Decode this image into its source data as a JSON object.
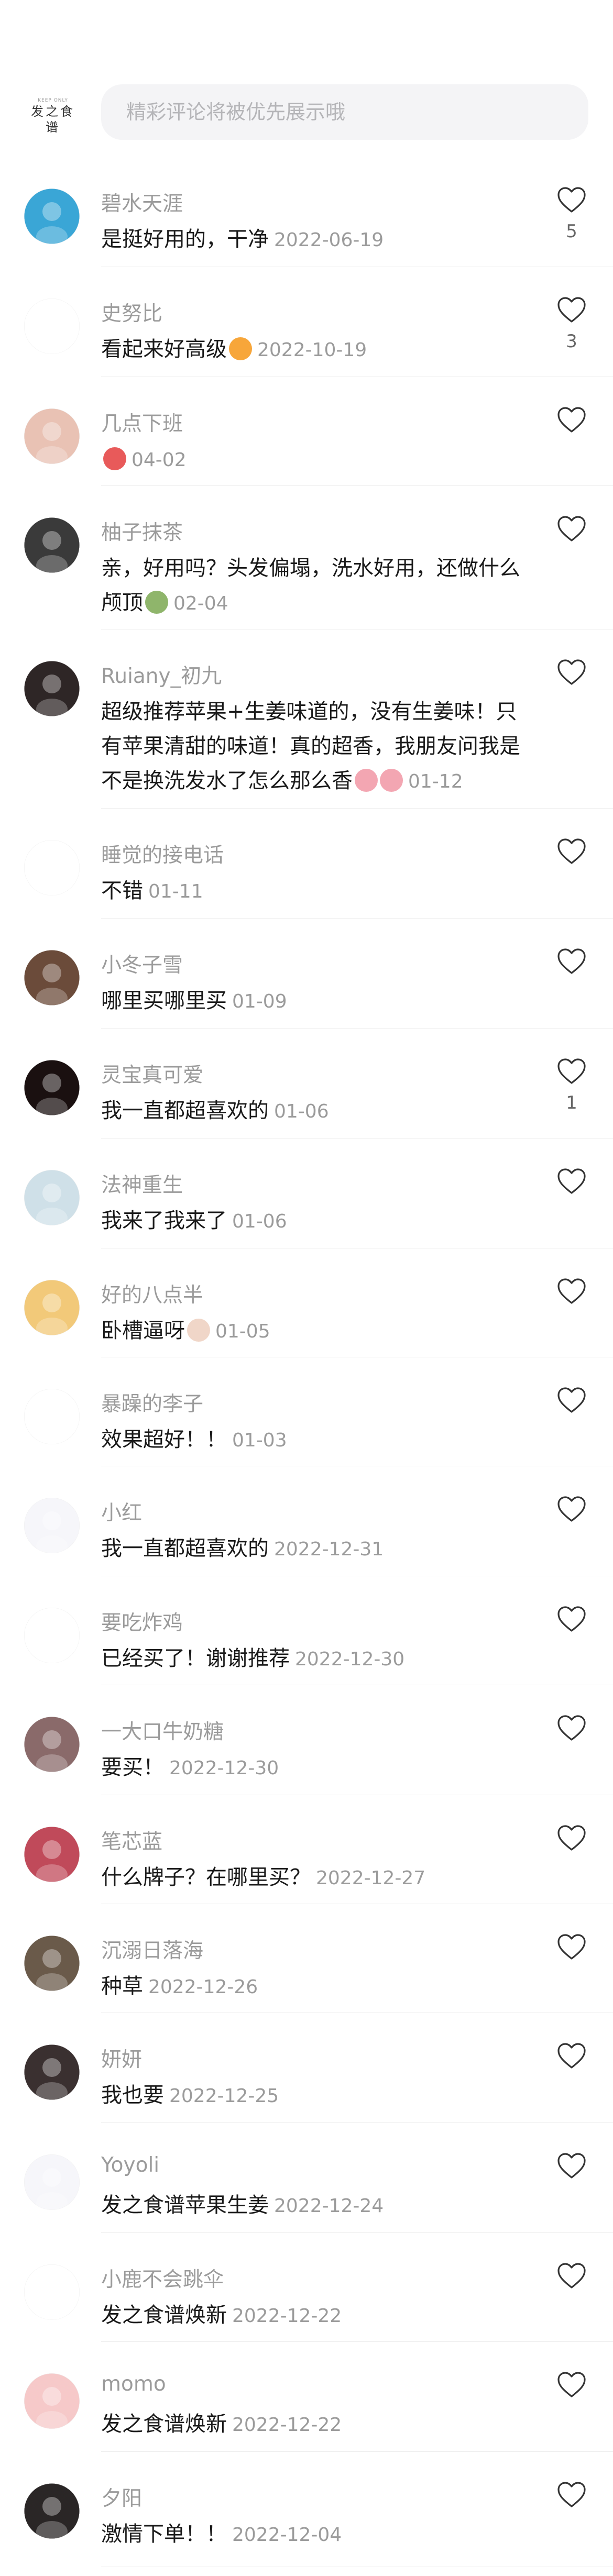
{
  "logo": {
    "small": "KEEP ONLY",
    "main": "发之食谱"
  },
  "search": {
    "placeholder": "精彩评论将被优先展示哦"
  },
  "comments": [
    {
      "user": "碧水天涯",
      "text": "是挺好用的，干净",
      "date": "2022-06-19",
      "likes": "5",
      "avatar_color": "#3aa6d6"
    },
    {
      "user": "史努比",
      "text": "看起来好高级",
      "date": "2022-10-19",
      "likes": "3",
      "avatar_color": "#ffffff"
    },
    {
      "user": "几点下班",
      "text": "",
      "date": "04-02",
      "likes": "",
      "avatar_color": "#e9c2b4"
    },
    {
      "user": "柚子抹茶",
      "text": "亲，好用吗？头发偏塌，洗水好用，还做什么颅顶",
      "date": "02-04",
      "likes": "",
      "avatar_color": "#3a3a3a"
    },
    {
      "user": "Ruiany_初九",
      "text": "超级推荐苹果+生姜味道的，没有生姜味！只有苹果清甜的味道！真的超香，我朋友问我是不是换洗发水了怎么那么香",
      "date": "01-12",
      "likes": "",
      "avatar_color": "#2e2626"
    },
    {
      "user": "睡觉的接电话",
      "text": "不错",
      "date": "01-11",
      "likes": "",
      "avatar_color": "#ffffff"
    },
    {
      "user": "小冬子雪",
      "text": "哪里买哪里买",
      "date": "01-09",
      "likes": "",
      "avatar_color": "#6b4b3a"
    },
    {
      "user": "灵宝真可爱",
      "text": "我一直都超喜欢的",
      "date": "01-06",
      "likes": "1",
      "avatar_color": "#1a1010"
    },
    {
      "user": "法神重生",
      "text": "我来了我来了",
      "date": "01-06",
      "likes": "",
      "avatar_color": "#cfe0e8"
    },
    {
      "user": "好的八点半",
      "text": "卧槽逼呀",
      "date": "01-05",
      "likes": "",
      "avatar_color": "#f2c979"
    },
    {
      "user": "暴躁的李子",
      "text": "效果超好！！",
      "date": "01-03",
      "likes": "",
      "avatar_color": "#ffffff"
    },
    {
      "user": "小红",
      "text": "我一直都超喜欢的",
      "date": "2022-12-31",
      "likes": "",
      "avatar_color": "#f6f6fa"
    },
    {
      "user": "要吃炸鸡",
      "text": "已经买了！谢谢推荐",
      "date": "2022-12-30",
      "likes": "",
      "avatar_color": "#ffffff"
    },
    {
      "user": "一大口牛奶糖",
      "text": "要买！",
      "date": "2022-12-30",
      "likes": "",
      "avatar_color": "#8a6a6a"
    },
    {
      "user": "笔芯蓝",
      "text": "什么牌子？在哪里买？",
      "date": "2022-12-27",
      "likes": "",
      "avatar_color": "#c04a5a"
    },
    {
      "user": "沉溺日落海",
      "text": "种草",
      "date": "2022-12-26",
      "likes": "",
      "avatar_color": "#6a5a4a"
    },
    {
      "user": "妍妍",
      "text": "我也要",
      "date": "2022-12-25",
      "likes": "",
      "avatar_color": "#3a3030"
    },
    {
      "user": "Yoyoli",
      "text": "发之食谱苹果生姜",
      "date": "2022-12-24",
      "likes": "",
      "avatar_color": "#f6f6fa"
    },
    {
      "user": "小鹿不会跳伞",
      "text": "发之食谱焕新",
      "date": "2022-12-22",
      "likes": "",
      "avatar_color": "#ffffff"
    },
    {
      "user": "momo",
      "text": "发之食谱焕新",
      "date": "2022-12-22",
      "likes": "",
      "avatar_color": "#f6c9c9"
    },
    {
      "user": "夕阳",
      "text": "激情下单！！",
      "date": "2022-12-04",
      "likes": "",
      "avatar_color": "#2a2626"
    }
  ]
}
